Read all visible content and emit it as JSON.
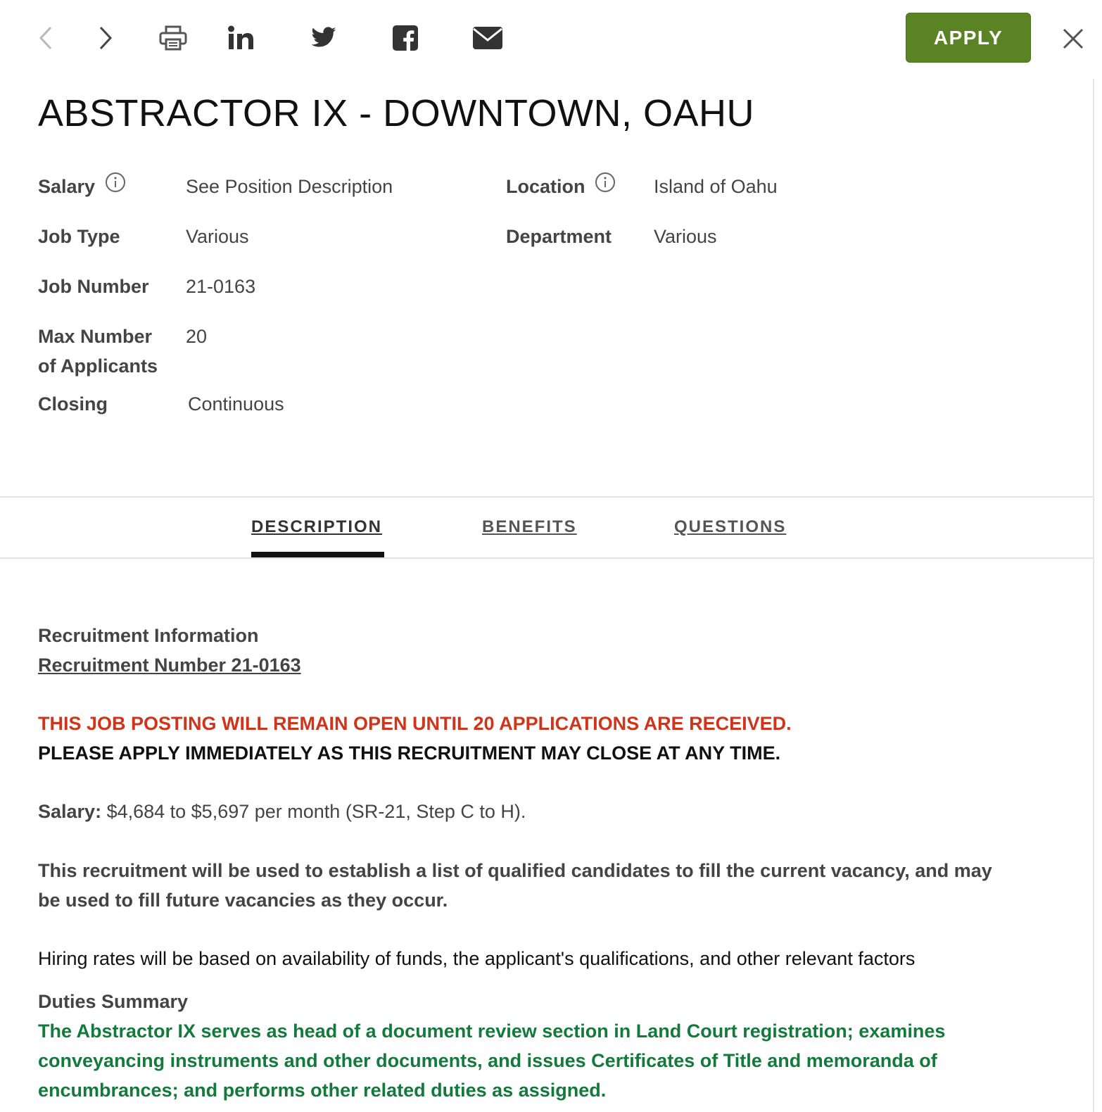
{
  "toolbar": {
    "icons": [
      "chevron-left-icon",
      "chevron-right-icon",
      "print-icon",
      "linkedin-icon",
      "twitter-icon",
      "facebook-icon",
      "email-icon",
      "close-icon"
    ],
    "apply_label": "APPLY",
    "accent_color": "#5a8423"
  },
  "job": {
    "title": "ABSTRACTOR IX - DOWNTOWN, OAHU",
    "salary_label": "Salary",
    "salary_value": "See Position Description",
    "location_label": "Location",
    "location_value": "Island of Oahu",
    "job_type_label": "Job Type",
    "job_type_value": "Various",
    "department_label": "Department",
    "department_value": "Various",
    "job_number_label": "Job Number",
    "job_number_value": "21-0163",
    "max_applicants_label_1": "Max Number",
    "max_applicants_label_2": "of Applicants",
    "max_applicants_value": "20",
    "closing_label": "Closing",
    "closing_value": "Continuous"
  },
  "tabs": {
    "description": "DESCRIPTION",
    "benefits": "BENEFITS",
    "questions": "QUESTIONS",
    "active": "DESCRIPTION"
  },
  "description": {
    "recruitment_heading": "Recruitment Information",
    "recruitment_number": "Recruitment Number 21-0163",
    "notice_red": "THIS JOB POSTING WILL REMAIN OPEN UNTIL 20 APPLICATIONS ARE RECEIVED.",
    "notice_black": "PLEASE APPLY IMMEDIATELY AS THIS RECRUITMENT MAY CLOSE AT ANY TIME.",
    "salary_label": "Salary:",
    "salary_text": " $4,684 to $5,697 per month (SR-21, Step C to H).",
    "list_line_1": "This recruitment will be used to establish a list of qualified candidates to fill the current vacancy, and may",
    "list_line_2": "be used to fill future vacancies as they occur.",
    "hiring_rates": "Hiring rates will be based on availability of funds, the applicant's qualifications, and other relevant factors",
    "duties_heading": "Duties Summary",
    "duties_line_1": "The Abstractor IX serves as head of a document review section in Land Court registration; examines",
    "duties_line_2": "conveyancing instruments and other documents, and issues Certificates of Title and memoranda of",
    "duties_line_3": "encumbrances; and performs other related duties as assigned."
  },
  "colors": {
    "notice_red": "#d0341a",
    "duties_green": "#137a3c"
  }
}
